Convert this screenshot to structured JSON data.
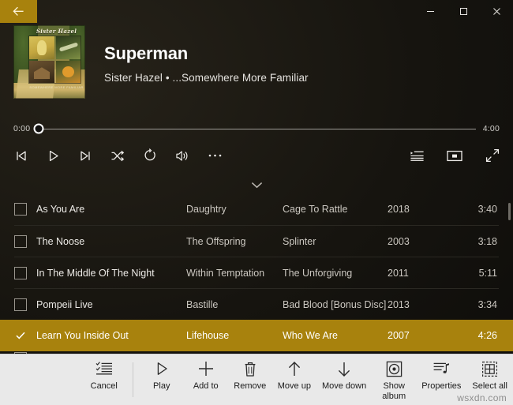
{
  "theme": {
    "accent": "#a8820d",
    "app_bg": "#16140f",
    "cmdbar_bg": "#e9e9e9",
    "text_primary": "#ffffff",
    "text_secondary": "#cbc7c0"
  },
  "titlebar": {
    "back_label": "Back",
    "back_icon": "arrow-left-icon",
    "minimize_label": "Minimize",
    "maximize_label": "Maximize",
    "close_label": "Close"
  },
  "now_playing": {
    "album_art": {
      "alt": "Sister Hazel - ...Somewhere More Familiar album cover",
      "cover_title": "Sister Hazel",
      "cover_subtitle": "SOMEWHERE MORE FAMILIAR"
    },
    "title": "Superman",
    "subtitle": "Sister Hazel • ...Somewhere More Familiar"
  },
  "transport": {
    "elapsed": "0:00",
    "duration": "4:00",
    "progress_percent": 0,
    "controls": [
      {
        "name": "previous-button",
        "label": "Previous"
      },
      {
        "name": "play-button",
        "label": "Play"
      },
      {
        "name": "next-button",
        "label": "Next"
      },
      {
        "name": "shuffle-button",
        "label": "Shuffle"
      },
      {
        "name": "repeat-button",
        "label": "Repeat"
      },
      {
        "name": "volume-button",
        "label": "Volume"
      },
      {
        "name": "more-button",
        "label": "More"
      }
    ],
    "right_controls": [
      {
        "name": "queue-button",
        "label": "Playing next"
      },
      {
        "name": "mini-player-button",
        "label": "Mini view"
      },
      {
        "name": "fullscreen-button",
        "label": "Full screen"
      }
    ]
  },
  "list": {
    "collapse_label": "Collapse",
    "scrollbar_label": "Scrollbar",
    "tracks": [
      {
        "title": "As You Are",
        "artist": "Daughtry",
        "album": "Cage To Rattle",
        "year": "2018",
        "duration": "3:40",
        "selected": false
      },
      {
        "title": "The Noose",
        "artist": "The Offspring",
        "album": "Splinter",
        "year": "2003",
        "duration": "3:18",
        "selected": false
      },
      {
        "title": "In The Middle Of The Night",
        "artist": "Within Temptation",
        "album": "The Unforgiving",
        "year": "2011",
        "duration": "5:11",
        "selected": false
      },
      {
        "title": "Pompeii Live",
        "artist": "Bastille",
        "album": "Bad Blood [Bonus Disc] |",
        "year": "2013",
        "duration": "3:34",
        "selected": false
      },
      {
        "title": "Learn You Inside Out",
        "artist": "Lifehouse",
        "album": "Who We Are",
        "year": "2007",
        "duration": "4:26",
        "selected": true
      }
    ]
  },
  "command_bar": {
    "items": [
      {
        "icon": "cancel-selection-icon",
        "label": "Cancel",
        "name": "cancel-button"
      },
      {
        "icon": "play-icon",
        "label": "Play",
        "name": "play-button"
      },
      {
        "icon": "plus-icon",
        "label": "Add to",
        "name": "add-to-button"
      },
      {
        "icon": "trash-icon",
        "label": "Remove",
        "name": "remove-button"
      },
      {
        "icon": "arrow-up-icon",
        "label": "Move up",
        "name": "move-up-button"
      },
      {
        "icon": "arrow-down-icon",
        "label": "Move down",
        "name": "move-down-button"
      },
      {
        "icon": "disc-icon",
        "label": "Show\nalbum",
        "name": "show-album-button"
      },
      {
        "icon": "properties-icon",
        "label": "Properties",
        "name": "properties-button"
      },
      {
        "icon": "select-all-icon",
        "label": "Select all",
        "name": "select-all-button"
      }
    ],
    "watermark": "wsxdn.com"
  }
}
